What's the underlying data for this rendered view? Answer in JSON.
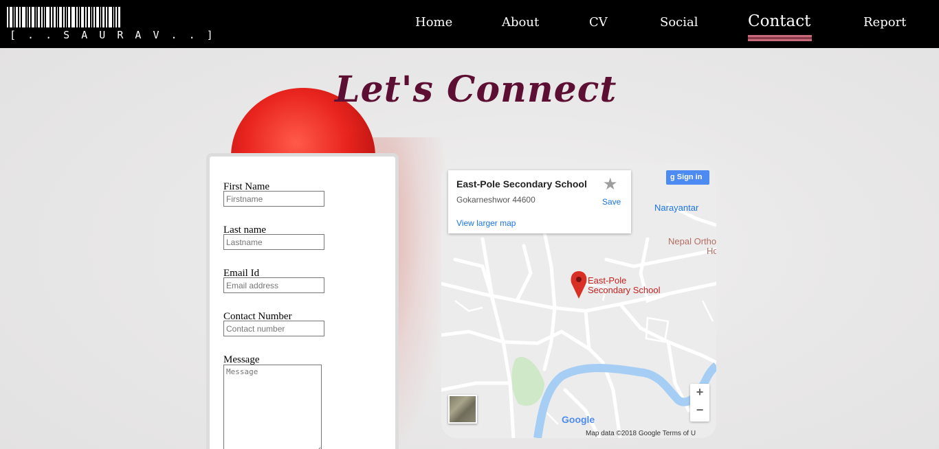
{
  "header": {
    "logo_text": "[ . . S A U R A V . . ]",
    "nav": [
      {
        "label": "Home"
      },
      {
        "label": "About"
      },
      {
        "label": "CV"
      },
      {
        "label": "Social"
      },
      {
        "label": "Contact",
        "active": true
      },
      {
        "label": "Report"
      }
    ]
  },
  "page_title": "Let's Connect",
  "form": {
    "first_name": {
      "label": "First Name",
      "placeholder": "Firstname"
    },
    "last_name": {
      "label": "Last name",
      "placeholder": "Lastname"
    },
    "email": {
      "label": "Email Id",
      "placeholder": "Email address"
    },
    "contact": {
      "label": "Contact Number",
      "placeholder": "Contact number"
    },
    "message": {
      "label": "Message",
      "placeholder": "Message"
    }
  },
  "map": {
    "place_name": "East-Pole Secondary School",
    "address": "Gokarneshwor 44600",
    "view_larger": "View larger map",
    "save_label": "Save",
    "signin_label": "Sign in",
    "pin_label_line1": "East-Pole",
    "pin_label_line2": "Secondary School",
    "label_narayantar": "Narayantar",
    "label_nepal_ortho_1": "Nepal Ortho",
    "label_nepal_ortho_2": "Ho",
    "google_logo": "Google",
    "attribution": "Map data ©2018 Google    Terms of U",
    "zoom_in": "+",
    "zoom_out": "−"
  },
  "colors": {
    "nav_bg": "#000000",
    "title": "#5c0e33",
    "active_underline": "#c86a7a",
    "pin": "#d93025",
    "river": "#a6cef5",
    "park": "#cfe8c8"
  }
}
